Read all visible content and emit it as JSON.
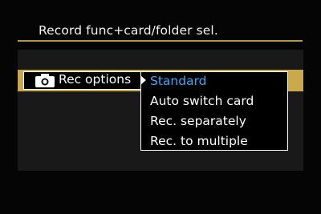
{
  "screen": {
    "title": "Record func+card/folder sel."
  },
  "menu": {
    "icon": "camera-icon",
    "label": "Rec options",
    "arrow_icon": "triangle-right-icon",
    "options": [
      {
        "label": "Standard",
        "selected": true
      },
      {
        "label": "Auto switch card",
        "selected": false
      },
      {
        "label": "Rec. separately",
        "selected": false
      },
      {
        "label": "Rec. to multiple",
        "selected": false
      }
    ]
  },
  "colors": {
    "background": "#050505",
    "panel": "#191919",
    "accent_gold": "#c9a94a",
    "underline": "#b89a3c",
    "selected_text": "#33aaff",
    "text": "#ffffff"
  }
}
